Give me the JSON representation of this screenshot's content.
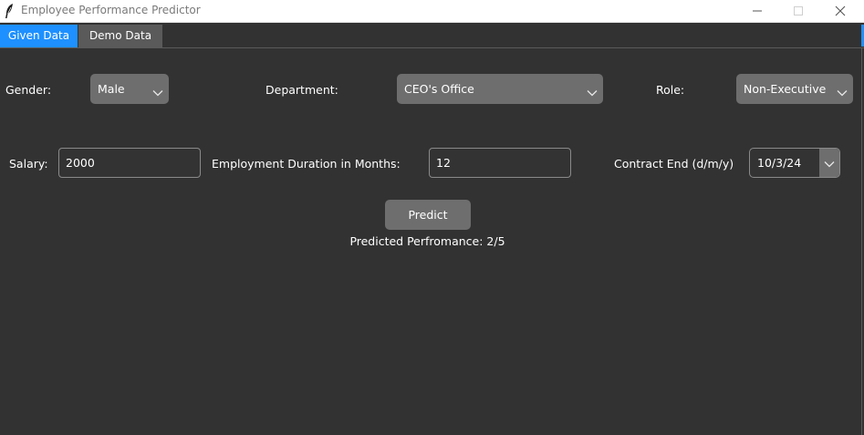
{
  "window": {
    "title": "Employee Performance Predictor"
  },
  "tabs": [
    {
      "label": "Given Data",
      "active": true
    },
    {
      "label": "Demo Data",
      "active": false
    }
  ],
  "form": {
    "gender": {
      "label": "Gender:",
      "value": "Male"
    },
    "department": {
      "label": "Department:",
      "value": "CEO's Office"
    },
    "role": {
      "label": "Role:",
      "value": "Non-Executive"
    },
    "salary": {
      "label": "Salary:",
      "value": "2000"
    },
    "duration": {
      "label": "Employment Duration in Months:",
      "value": "12"
    },
    "contract_end": {
      "label": "Contract End (d/m/y)",
      "value": "10/3/24"
    }
  },
  "predict_button": {
    "label": "Predict"
  },
  "result": {
    "text": "Predicted Perfromance: 2/5"
  },
  "colors": {
    "background": "#323232",
    "active_tab": "#1e90ff",
    "inactive_tab": "#5a5a5a",
    "control": "#6e6e6e",
    "text": "#ffffff"
  },
  "icons": {
    "app": "feather-icon",
    "minimize": "minimize-icon",
    "maximize": "maximize-icon",
    "close": "close-icon",
    "dropdown": "chevron-down-icon"
  }
}
